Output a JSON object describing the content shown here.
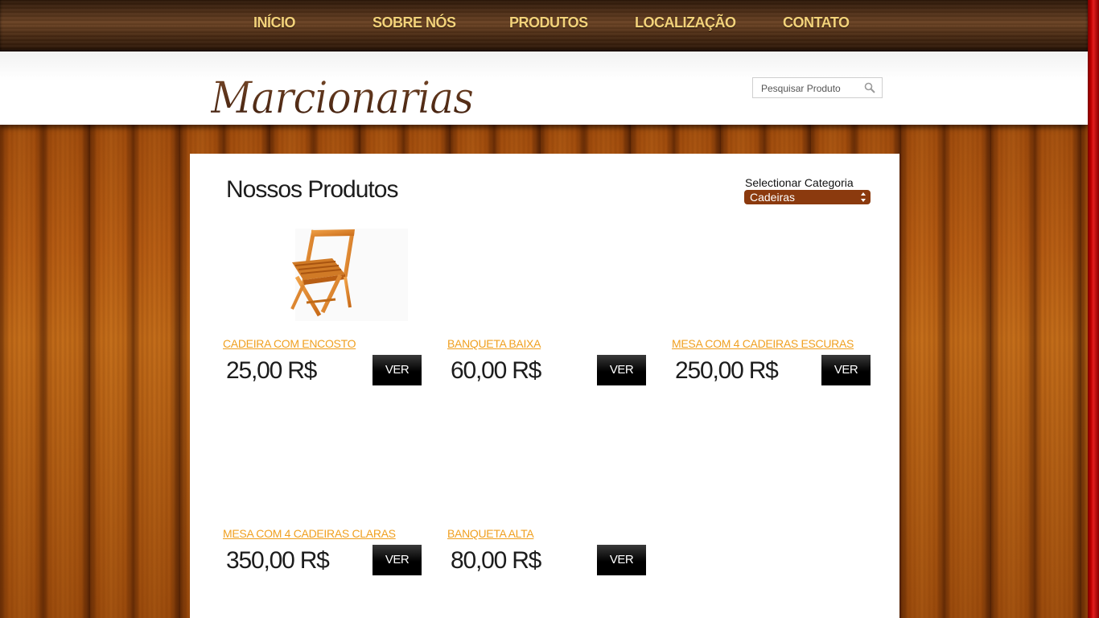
{
  "nav": {
    "items": [
      {
        "label": "INÍCIO"
      },
      {
        "label": "SOBRE NÓS"
      },
      {
        "label": "PRODUTOS"
      },
      {
        "label": "LOCALIZAÇÃO"
      },
      {
        "label": "CONTATO"
      }
    ]
  },
  "header": {
    "logo_text": "Marcionarias",
    "search_placeholder": "Pesquisar Produto",
    "search_icon": "search-icon"
  },
  "main": {
    "title": "Nossos Produtos",
    "category": {
      "label": "Selectionar Categoria",
      "selected": "Cadeiras"
    },
    "button_label": "VER",
    "products": [
      {
        "name": "CADEIRA COM ENCOSTO",
        "price": "25,00 R$",
        "image": "folding-wooden-chair"
      },
      {
        "name": "BANQUETA BAIXA",
        "price": "60,00 R$"
      },
      {
        "name": "MESA COM 4 CADEIRAS ESCURAS",
        "price": "250,00 R$"
      },
      {
        "name": "MESA COM 4 CADEIRAS CLARAS",
        "price": "350,00 R$"
      },
      {
        "name": "BANQUETA ALTA",
        "price": "80,00 R$"
      }
    ]
  },
  "colors": {
    "nav_text": "#f3d27a",
    "product_link": "#f0a020",
    "select_bg": "#8b3a0e",
    "button_bg": "#000000"
  }
}
